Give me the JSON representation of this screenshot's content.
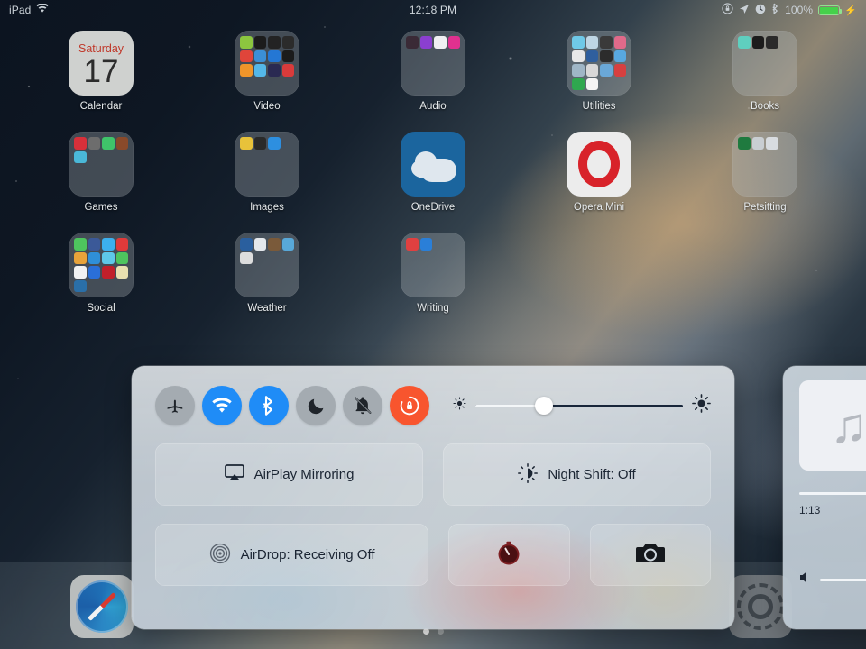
{
  "status_bar": {
    "device_label": "iPad",
    "wifi_icon": "wifi-icon",
    "time": "12:18 PM",
    "rotation_lock_icon": "rotation-lock-icon",
    "location_icon": "location-arrow-icon",
    "alarm_icon": "alarm-clock-icon",
    "bluetooth_icon": "bluetooth-icon",
    "battery_percent": "100%",
    "charging_icon": "charging-bolt-icon"
  },
  "home_screen": {
    "rows": [
      [
        {
          "label": "Calendar",
          "type": "calendar",
          "weekday": "Saturday",
          "day": "17"
        },
        {
          "label": "Video",
          "type": "folder"
        },
        {
          "label": "Audio",
          "type": "folder"
        },
        {
          "label": "Utilities",
          "type": "folder"
        },
        {
          "label": "Books",
          "type": "folder"
        }
      ],
      [
        {
          "label": "Games",
          "type": "folder"
        },
        {
          "label": "Images",
          "type": "folder"
        },
        {
          "label": "OneDrive",
          "type": "app"
        },
        {
          "label": "Opera Mini",
          "type": "app"
        },
        {
          "label": "Petsitting",
          "type": "folder"
        }
      ],
      [
        {
          "label": "Social",
          "type": "folder"
        },
        {
          "label": "Weather",
          "type": "folder"
        },
        {
          "label": "Writing",
          "type": "folder"
        }
      ]
    ],
    "page_dots": {
      "count": 2,
      "active_index": 0
    }
  },
  "dock": {
    "items": [
      {
        "label": "Safari",
        "icon": "safari-compass-icon"
      },
      {
        "label": "Settings",
        "icon": "settings-gear-icon"
      }
    ]
  },
  "control_center": {
    "toggles": [
      {
        "name": "airplane-mode",
        "icon": "airplane-icon",
        "state": "off",
        "color": "#a4abb1"
      },
      {
        "name": "wifi",
        "icon": "wifi-icon",
        "state": "on",
        "color": "#1f8cf7"
      },
      {
        "name": "bluetooth",
        "icon": "bluetooth-icon",
        "state": "on",
        "color": "#1f8cf7"
      },
      {
        "name": "do-not-disturb",
        "icon": "moon-icon",
        "state": "off",
        "color": "#a4abb1"
      },
      {
        "name": "mute",
        "icon": "bell-slash-icon",
        "state": "off",
        "color": "#a4abb1"
      },
      {
        "name": "rotation-lock",
        "icon": "rotation-lock-icon",
        "state": "on",
        "color": "#f8552e"
      }
    ],
    "brightness": {
      "icon_low": "sun-small-icon",
      "icon_high": "sun-large-icon",
      "value_percent": 33
    },
    "airplay": {
      "label": "AirPlay Mirroring",
      "icon": "airplay-icon"
    },
    "night_shift": {
      "label": "Night Shift: Off",
      "icon": "night-shift-icon"
    },
    "airdrop": {
      "label": "AirDrop: Receiving Off",
      "icon": "airdrop-icon"
    },
    "timer": {
      "icon": "timer-icon"
    },
    "camera": {
      "icon": "camera-icon"
    }
  },
  "music_panel": {
    "album_art_icon": "music-note-icon",
    "elapsed_time": "1:13",
    "volume_icon": "speaker-icon"
  }
}
